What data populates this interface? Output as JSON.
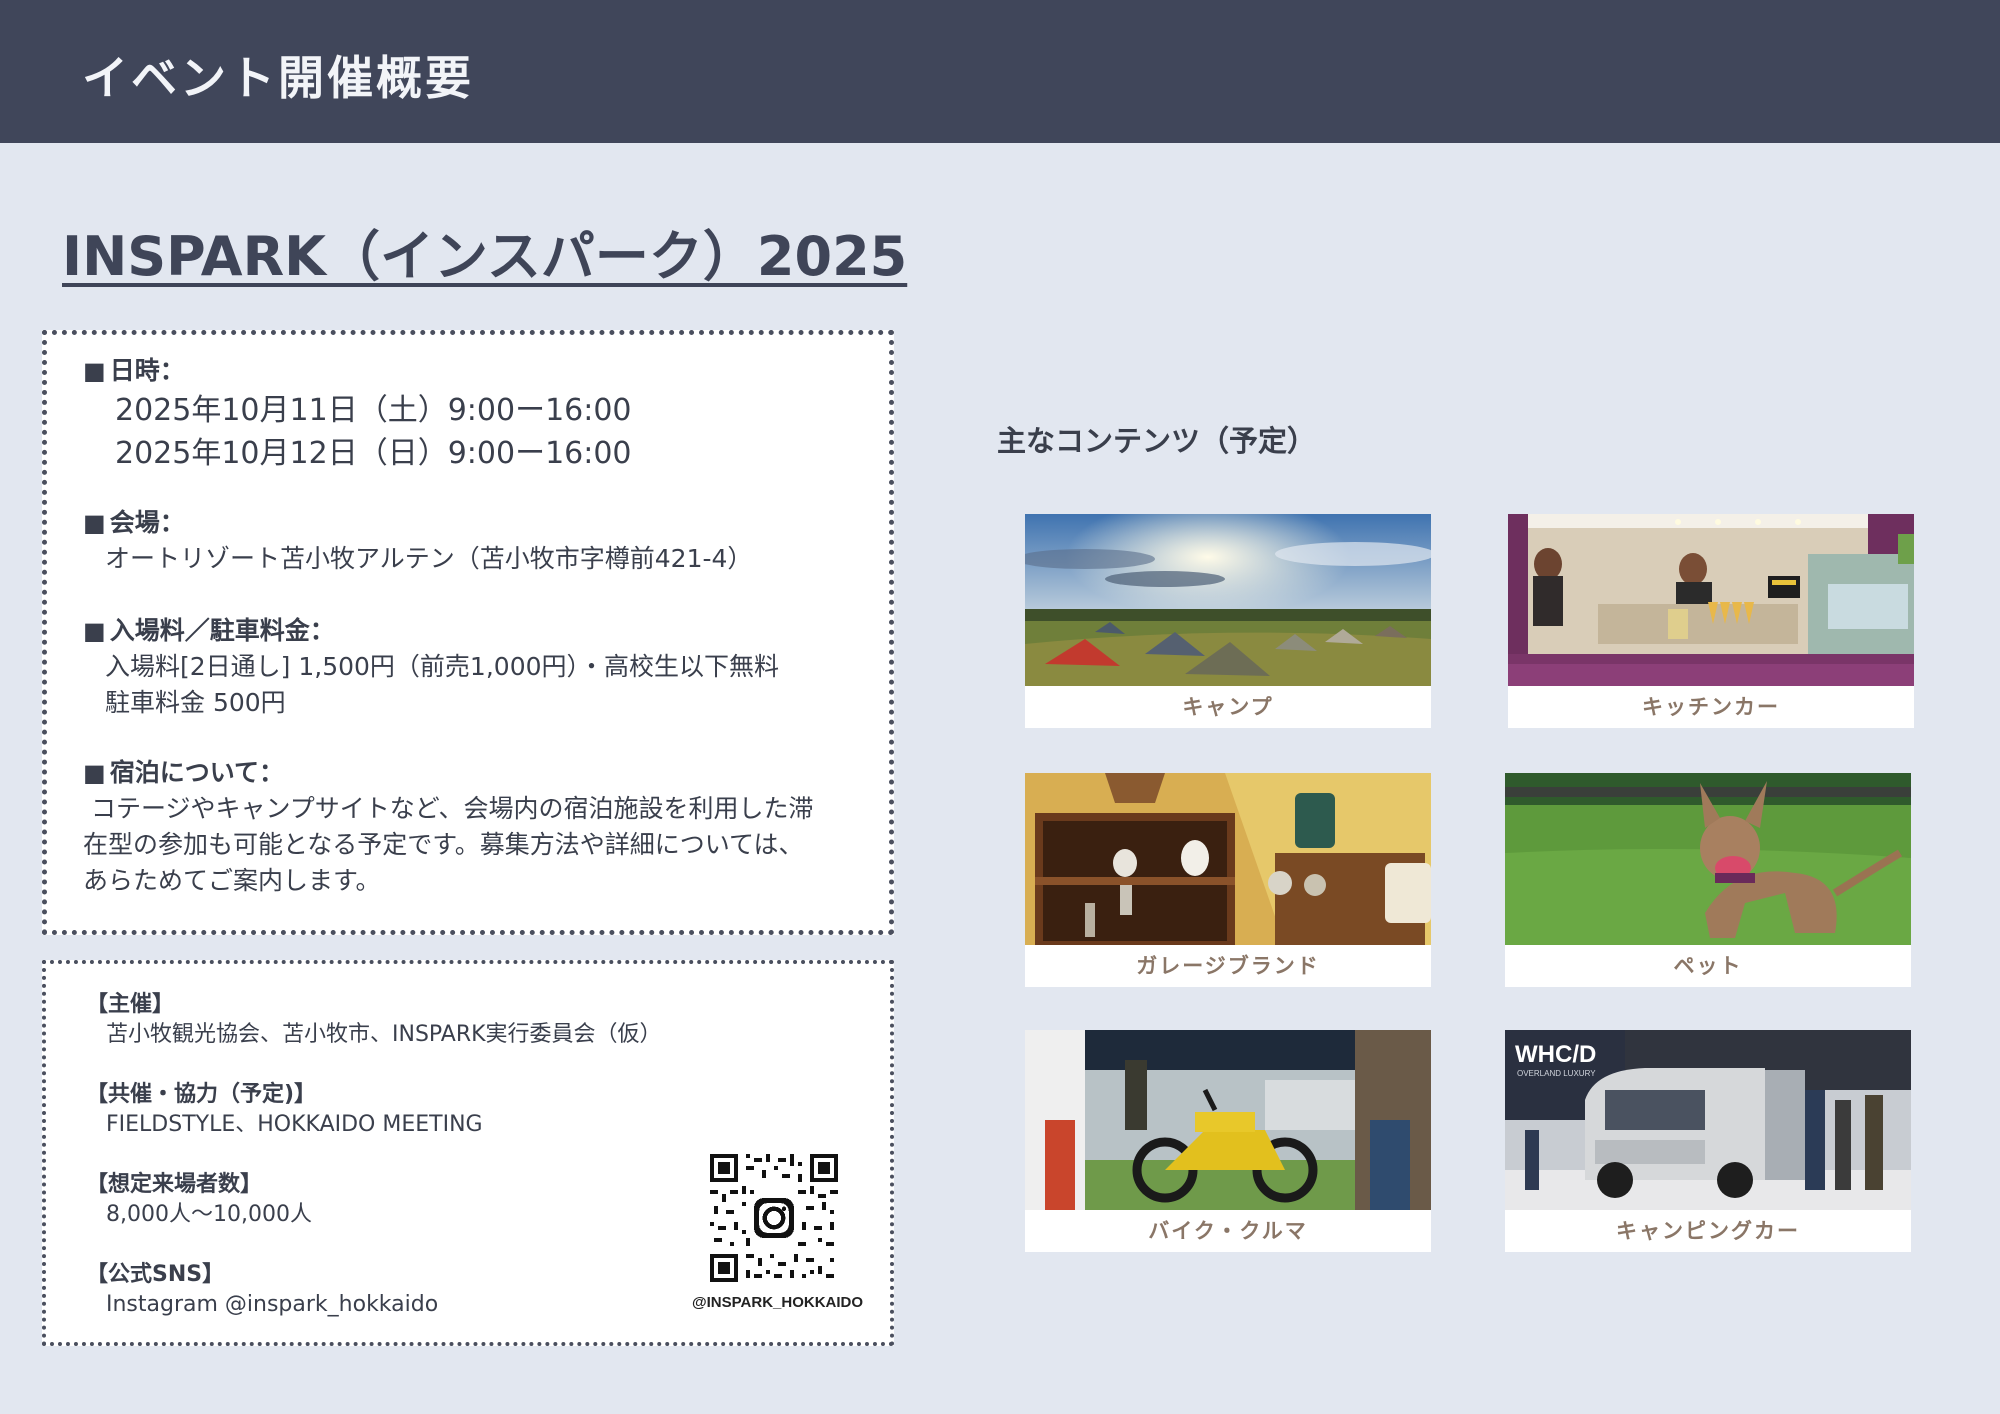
{
  "header": {
    "title": "イベント開催概要"
  },
  "event": {
    "title": "INSPARK（インスパーク）2025"
  },
  "info": {
    "date": {
      "heading": "日時：",
      "lines": [
        "2025年10月11日（土）9:00ー16:00",
        "2025年10月12日（日）9:00ー16:00"
      ]
    },
    "venue": {
      "heading": "会場：",
      "lines": [
        "オートリゾート苫小牧アルテン（苫小牧市字樽前421-4）"
      ]
    },
    "fee": {
      "heading": "入場料／駐車料金：",
      "lines": [
        "入場料[2日通し] 1,500円（前売1,000円）・高校生以下無料",
        "駐車料金 500円"
      ]
    },
    "stay": {
      "heading": "宿泊について：",
      "lines": [
        " コテージやキャンプサイトなど、会場内の宿泊施設を利用した滞",
        "在型の参加も可能となる予定です。募集方法や詳細については、",
        "あらためてご案内します。"
      ]
    }
  },
  "organizers": {
    "host": {
      "heading": "【主催】",
      "value": "苫小牧観光協会、苫小牧市、INSPARK実行委員会（仮）"
    },
    "co": {
      "heading": "【共催・協力（予定)】",
      "value": "FIELDSTYLE、HOKKAIDO MEETING"
    },
    "visitors": {
      "heading": "【想定来場者数】",
      "value": "8,000人〜10,000人"
    },
    "sns": {
      "heading": "【公式SNS】",
      "value": "Instagram @inspark_hokkaido"
    },
    "qr_caption": "@INSPARK_HOKKAIDO"
  },
  "contents": {
    "title": "主なコンテンツ（予定）",
    "items": [
      {
        "label": "キャンプ",
        "icon": "camp-photo"
      },
      {
        "label": "キッチンカー",
        "icon": "kitchen-car-photo"
      },
      {
        "label": "ガレージブランド",
        "icon": "garage-brand-photo"
      },
      {
        "label": "ペット",
        "icon": "pet-photo"
      },
      {
        "label": "バイク・クルマ",
        "icon": "bike-car-photo"
      },
      {
        "label": "キャンピングカー",
        "icon": "camping-car-photo"
      }
    ],
    "van_brand": "WHC/D",
    "van_sub": "OVERLAND LUXURY"
  },
  "colors": {
    "header_bg": "#40465a",
    "page_bg": "#e2e7f0",
    "caption_text": "#8a7667"
  }
}
